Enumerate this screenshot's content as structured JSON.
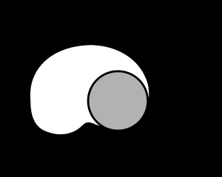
{
  "canvas": {
    "background_color": "#000000"
  },
  "shapes": {
    "crescent": {
      "fill": "#ffffff"
    },
    "circle": {
      "fill": "#b2b2b2",
      "stroke": "#000000"
    }
  }
}
